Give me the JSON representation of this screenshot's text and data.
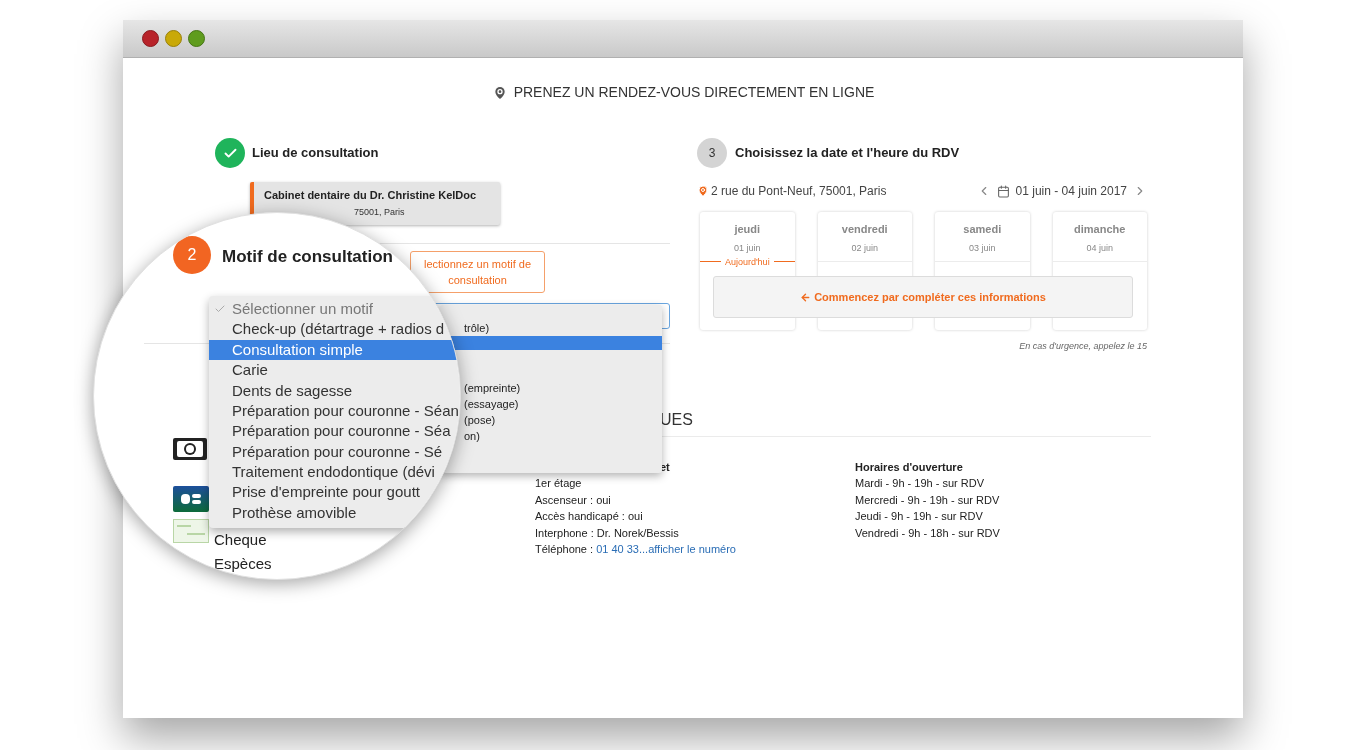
{
  "header": {
    "title": "PRENEZ UN RENDEZ-VOUS DIRECTEMENT EN LIGNE"
  },
  "location_step": {
    "title": "Lieu de consultation",
    "done": true,
    "card": {
      "name": "Cabinet dentaire du Dr. Christine KelDoc",
      "address": "75001, Paris"
    }
  },
  "motif_step": {
    "tooltip": "lectionnez un motif de consultation",
    "menu_rows": [
      {
        "selected": false
      },
      {
        "text": "trôle)",
        "selected": false
      },
      {
        "selected": true
      },
      {
        "selected": false
      },
      {
        "selected": false
      },
      {
        "text": "(empreinte)",
        "selected": false
      },
      {
        "text": "(essayage)",
        "selected": false
      },
      {
        "text": "(pose)",
        "selected": false
      },
      {
        "text": "on)",
        "selected": false
      },
      {
        "selected": false
      },
      {
        "selected": false
      }
    ]
  },
  "date_step": {
    "number": "3",
    "title": "Choisissez la date et l'heure du RDV",
    "address": "2 rue du Pont-Neuf, 75001, Paris",
    "range": "01 juin - 04 juin 2017",
    "days": [
      {
        "day": "jeudi",
        "date": "01 juin",
        "today": "Aujourd'hui"
      },
      {
        "day": "vendredi",
        "date": "02 juin"
      },
      {
        "day": "samedi",
        "date": "03 juin"
      },
      {
        "day": "dimanche",
        "date": "04 juin"
      }
    ],
    "notice": "Commencez par compléter ces informations",
    "urgency": "En cas d'urgence, appelez le 15"
  },
  "info": {
    "heading": "UES",
    "access": {
      "title": "et",
      "lines": [
        "1er étage",
        "Ascenseur : oui",
        "Accès handicapé : oui",
        "Interphone : Dr. Norek/Bessis"
      ],
      "phone_label": "Téléphone : ",
      "phone_link": "01 40 33...afficher le numéro"
    },
    "hours": {
      "title": "Horaires d'ouverture",
      "lines": [
        "Mardi - 9h - 19h - sur RDV",
        "Mercredi - 9h - 19h - sur RDV",
        "Jeudi - 9h - 19h - sur RDV",
        "Vendredi - 9h - 18h - sur RDV"
      ]
    }
  },
  "magnifier": {
    "step": "2",
    "title": "Motif de consultation",
    "options": [
      {
        "label": "Sélectionner un motif",
        "checked": true,
        "selected": false
      },
      {
        "label": "Check-up (détartrage + radios d",
        "checked": false,
        "selected": false
      },
      {
        "label": "Consultation simple",
        "checked": false,
        "selected": true
      },
      {
        "label": "Carie",
        "checked": false,
        "selected": false
      },
      {
        "label": "Dents de sagesse",
        "checked": false,
        "selected": false
      },
      {
        "label": "Préparation pour couronne - Séan",
        "checked": false,
        "selected": false
      },
      {
        "label": "Préparation pour couronne - Séa",
        "checked": false,
        "selected": false
      },
      {
        "label": "Préparation pour couronne - Sé",
        "checked": false,
        "selected": false
      },
      {
        "label": "Traitement endodontique (dévi",
        "checked": false,
        "selected": false
      },
      {
        "label": "Prise d'empreinte pour goutt",
        "checked": false,
        "selected": false
      },
      {
        "label": "Prothèse amovible",
        "checked": false,
        "selected": false
      }
    ],
    "payments": [
      {
        "kind": "bill"
      },
      {
        "kind": "card"
      },
      {
        "kind": "cheque",
        "label": "Cheque"
      },
      {
        "kind": "cash",
        "label": "Espèces"
      }
    ]
  }
}
